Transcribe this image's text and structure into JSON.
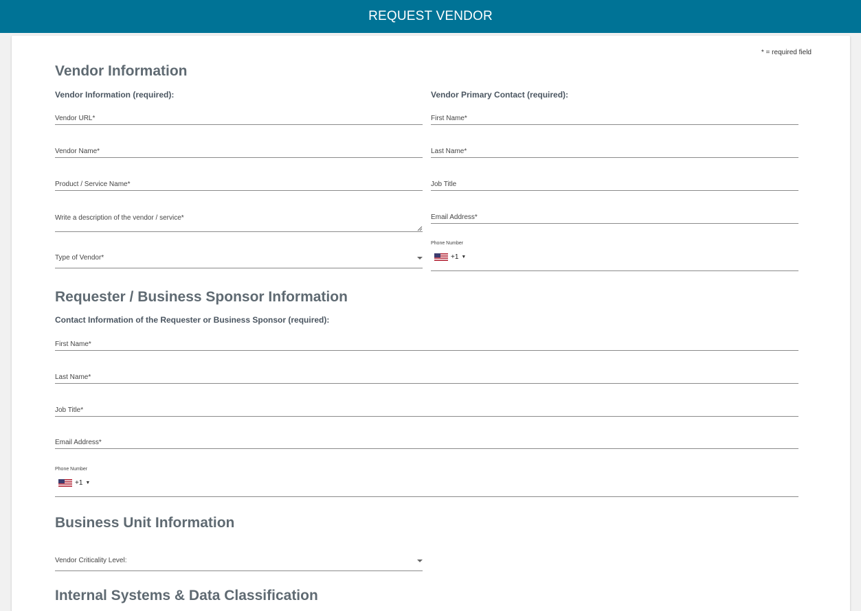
{
  "header": {
    "title": "REQUEST VENDOR"
  },
  "form": {
    "required_note": "* = required field",
    "vendor_section": {
      "title": "Vendor Information",
      "left_subtitle": "Vendor Information (required):",
      "right_subtitle": "Vendor Primary Contact (required):",
      "left_fields": [
        "Vendor URL*",
        "Vendor Name*",
        "Product / Service Name*",
        "Write a description of the vendor / service*",
        "Type of Vendor*"
      ],
      "right_fields": [
        "First Name*",
        "Last Name*",
        "Job Title",
        "Email Address*"
      ],
      "phone": {
        "label": "Phone Number",
        "country_code": "+1",
        "flag_icon": "us-flag-icon"
      }
    },
    "requester_section": {
      "title": "Requester / Business Sponsor Information",
      "subtitle": "Contact Information of the Requester or Business Sponsor (required):",
      "fields": [
        "First Name*",
        "Last Name*",
        "Job Title*",
        "Email Address*"
      ],
      "phone": {
        "label": "Phone Number",
        "country_code": "+1",
        "flag_icon": "us-flag-icon"
      }
    },
    "business_unit_section": {
      "title": "Business Unit Information",
      "fields": [
        "Vendor Criticality Level:"
      ]
    },
    "internal_systems_section": {
      "title": "Internal Systems & Data Classification"
    }
  },
  "colors": {
    "header_bg": "#007396",
    "section_title": "#5f6a72",
    "page_bg": "#f1f1f1"
  }
}
